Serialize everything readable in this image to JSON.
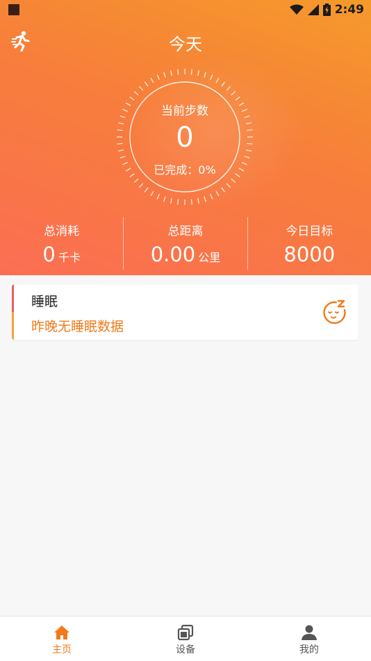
{
  "status_bar": {
    "time": "2:49"
  },
  "header": {
    "title": "今天"
  },
  "dial": {
    "label": "当前步数",
    "value": "0",
    "completed": "已完成：0%"
  },
  "stats": [
    {
      "label": "总消耗",
      "value": "0",
      "unit": "千卡"
    },
    {
      "label": "总距离",
      "value": "0.00",
      "unit": "公里"
    },
    {
      "label": "今日目标",
      "value": "8000",
      "unit": ""
    }
  ],
  "sleep": {
    "title": "睡眠",
    "subtitle": "昨晚无睡眠数据"
  },
  "tabbar": {
    "tabs": [
      {
        "label": "主页"
      },
      {
        "label": "设备"
      },
      {
        "label": "我的"
      }
    ]
  },
  "colors": {
    "accent": "#f07a1a",
    "header_start": "#f59a2a",
    "header_end": "#fb6e53"
  },
  "icons": {
    "nav": "running-man-icon",
    "sleep": "sleep-face-icon",
    "home": "home-icon",
    "device": "device-icon",
    "profile": "person-icon"
  }
}
